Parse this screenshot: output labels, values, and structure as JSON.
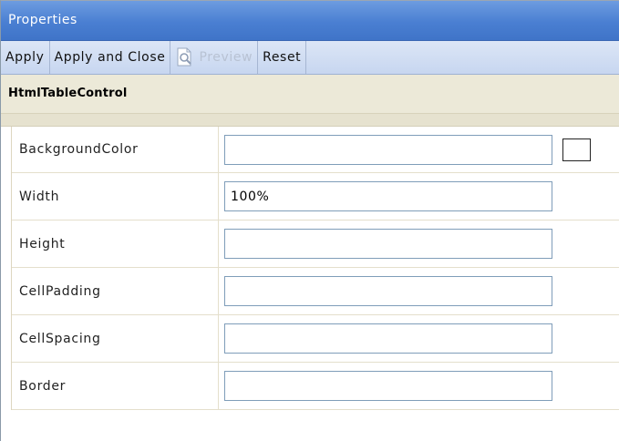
{
  "window": {
    "title": "Properties"
  },
  "toolbar": {
    "apply_label": "Apply",
    "apply_close_label": "Apply and Close",
    "preview_label": "Preview",
    "reset_label": "Reset",
    "preview_icon": "page-magnifier-icon"
  },
  "control": {
    "name": "HtmlTableControl"
  },
  "properties": [
    {
      "label": "BackgroundColor",
      "value": ""
    },
    {
      "label": "Width",
      "value": "100%"
    },
    {
      "label": "Height",
      "value": ""
    },
    {
      "label": "CellPadding",
      "value": ""
    },
    {
      "label": "CellSpacing",
      "value": ""
    },
    {
      "label": "Border",
      "value": ""
    }
  ],
  "colors": {
    "titlebar": "#4a7fd2",
    "toolbar": "#c7d6f0",
    "header_strip": "#ece9d8",
    "input_border": "#7f9db9"
  }
}
